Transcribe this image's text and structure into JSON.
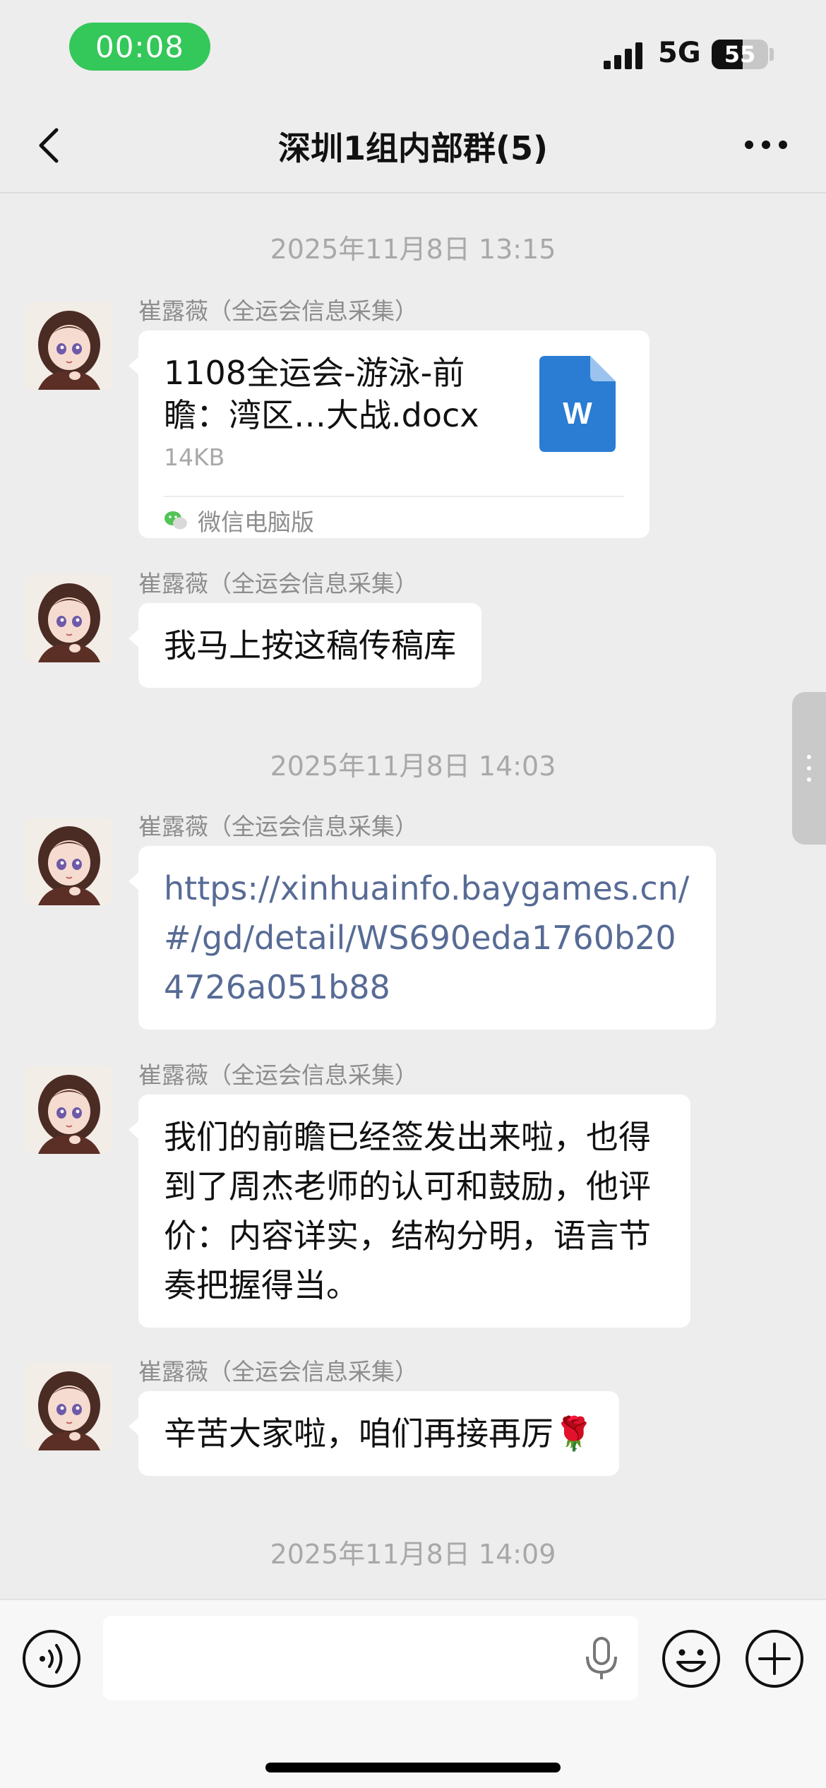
{
  "status_bar": {
    "time": "00:08",
    "network": "5G",
    "battery_level": "55",
    "battery_fraction": 0.55
  },
  "nav": {
    "title": "深圳1组内部群(5)",
    "back_icon": "chevron-left-icon",
    "more_icon": "more-dots-icon"
  },
  "messages": [
    {
      "type": "timestamp",
      "text": "2025年11月8日 13:15"
    },
    {
      "type": "file",
      "sender": "崔露薇（全运会信息采集）",
      "file_name": "1108全运会-游泳-前瞻：湾区…大战.docx",
      "file_size": "14KB",
      "file_icon": "W",
      "source": "微信电脑版"
    },
    {
      "type": "text",
      "sender": "崔露薇（全运会信息采集）",
      "text": "我马上按这稿传稿库"
    },
    {
      "type": "timestamp",
      "text": "2025年11月8日 14:03"
    },
    {
      "type": "link",
      "sender": "崔露薇（全运会信息采集）",
      "text": "https://xinhuainfo.baygames.cn/#/gd/detail/WS690eda1760b204726a051b88"
    },
    {
      "type": "text",
      "sender": "崔露薇（全运会信息采集）",
      "text": "我们的前瞻已经签发出来啦，也得到了周杰老师的认可和鼓励，他评价：内容详实，结构分明，语言节奏把握得当。"
    },
    {
      "type": "text",
      "sender": "崔露薇（全运会信息采集）",
      "text": "辛苦大家啦，咱们再接再厉🌹"
    },
    {
      "type": "timestamp",
      "text": "2025年11月8日 14:09"
    }
  ],
  "input_bar": {
    "placeholder": "",
    "voice_icon": "voice-icon",
    "mic_icon": "microphone-icon",
    "emoji_icon": "emoji-icon",
    "plus_icon": "plus-icon"
  },
  "colors": {
    "background": "#ededed",
    "link": "#576b95",
    "time_pill": "#34c759",
    "word_icon": "#2b7cd3"
  }
}
